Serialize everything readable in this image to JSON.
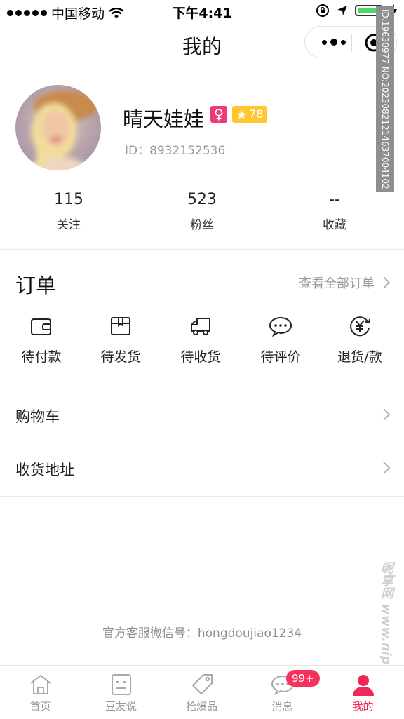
{
  "status_bar": {
    "carrier": "中国移动",
    "time": "下午4:41"
  },
  "nav": {
    "title": "我的"
  },
  "watermark": {
    "strip": "ID:19630977 NO:20230821214637004102",
    "logo": "昵享网 www.nipic.cn"
  },
  "profile": {
    "name": "晴天娃娃",
    "gender_symbol": "♀",
    "level": "78",
    "id_text": "ID：8932152536"
  },
  "stats": [
    {
      "value": "115",
      "label": "关注"
    },
    {
      "value": "523",
      "label": "粉丝"
    },
    {
      "value": "--",
      "label": "收藏"
    }
  ],
  "orders": {
    "title": "订单",
    "view_all": "查看全部订单",
    "items": [
      {
        "label": "待付款",
        "icon": "wallet-icon"
      },
      {
        "label": "待发货",
        "icon": "package-icon"
      },
      {
        "label": "待收货",
        "icon": "truck-icon"
      },
      {
        "label": "待评价",
        "icon": "comment-icon"
      },
      {
        "label": "退货/款",
        "icon": "refund-icon"
      }
    ]
  },
  "list": [
    {
      "label": "购物车"
    },
    {
      "label": "收货地址"
    }
  ],
  "service": "官方客服微信号：hongdoujiao1234",
  "tabbar": {
    "items": [
      {
        "label": "首页",
        "icon": "home-icon"
      },
      {
        "label": "豆友说",
        "icon": "feed-icon"
      },
      {
        "label": "抢爆品",
        "icon": "tag-icon"
      },
      {
        "label": "消息",
        "icon": "message-icon",
        "badge": "99+"
      },
      {
        "label": "我的",
        "icon": "profile-icon",
        "active": true
      }
    ]
  },
  "colors": {
    "accent": "#f0285a",
    "badge": "#f5325c",
    "gender": "#ee3a7a",
    "level": "#ffc730"
  }
}
